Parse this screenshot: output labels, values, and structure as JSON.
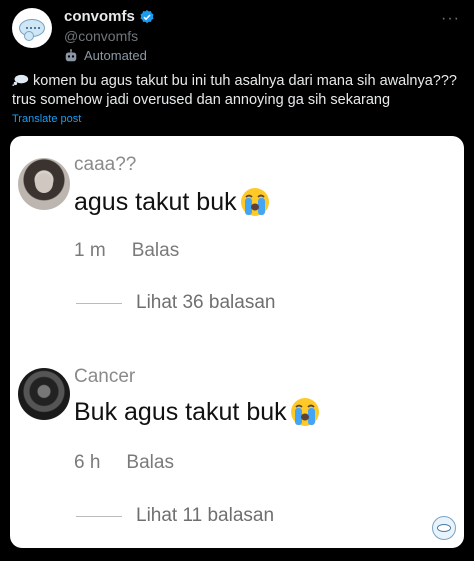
{
  "post": {
    "author": {
      "display_name": "convomfs",
      "handle": "@convomfs",
      "automated_label": "Automated",
      "verified": true
    },
    "more_label": "···",
    "text_line1": "komen bu agus takut bu ini tuh asalnya dari mana sih awalnya???",
    "text_line2": "trus somehow jadi overused dan annoying ga sih sekarang",
    "translate_label": "Translate post",
    "accent_color": "#1d9bf0"
  },
  "media": {
    "comments": [
      {
        "username": "caaa??",
        "text": "agus takut buk",
        "emoji": "loudly-crying-face-icon",
        "time": "1 m",
        "reply_label": "Balas",
        "view_replies": "Lihat 36 balasan"
      },
      {
        "username": "Cancer",
        "text": "Buk agus takut buk",
        "emoji": "loudly-crying-face-icon",
        "time": "6 h",
        "reply_label": "Balas",
        "view_replies": "Lihat 11 balasan"
      }
    ]
  }
}
